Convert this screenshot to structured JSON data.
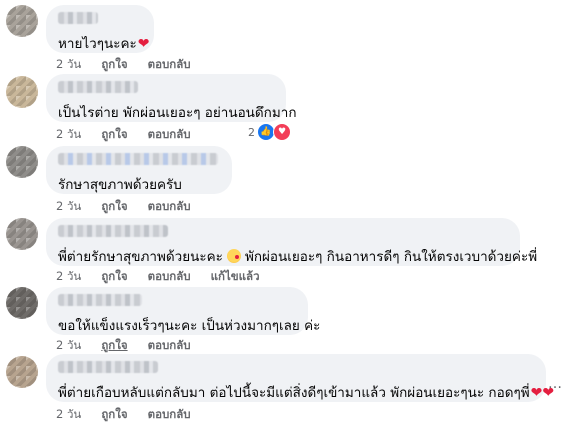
{
  "comments": [
    {
      "text": "หายไวๆนะคะ",
      "heart": "❤",
      "time": "2 วัน",
      "like": "ถูกใจ",
      "reply": "ตอบกลับ",
      "avatar_color": "#a9a39b"
    },
    {
      "text": "เป็นไรต่าย พักผ่อนเยอะๆ อย่านอนดึกมาก",
      "time": "2 วัน",
      "like": "ถูกใจ",
      "reply": "ตอบกลับ",
      "reaction_count": "2",
      "avatar_color": "#c9b79a"
    },
    {
      "text": "รักษาสุขภาพด้วยครับ",
      "time": "2 วัน",
      "like": "ถูกใจ",
      "reply": "ตอบกลับ",
      "avatar_color": "#8f8d8a"
    },
    {
      "text_before": "พี่ต่ายรักษาสุขภาพด้วยนะคะ",
      "emoji": "face-blowing-kiss",
      "text_after": "พักผ่อนเยอะๆ กินอาหารดีๆ กินให้ตรงเวบาด้วยค่ะพี่",
      "time": "2 วัน",
      "like": "ถูกใจ",
      "reply": "ตอบกลับ",
      "edited": "แก้ไขแล้ว",
      "avatar_color": "#9a9591"
    },
    {
      "text": "ขอให้แข็งแรงเร็วๆนะคะ เป็นห่วงมากๆเลย ค่ะ",
      "time": "2 วัน",
      "like": "ถูกใจ",
      "reply": "ตอบกลับ",
      "avatar_color": "#6f6c69"
    },
    {
      "text": "พี่ต่ายเกือบหลับแต่กลับมา ต่อไปนี้จะมีแต่สิ่งดีๆเข้ามาแล้ว พักผ่อนเยอะๆนะ กอดๆพี่",
      "hearts": "❤❤",
      "time": "2 วัน",
      "like": "ถูกใจ",
      "reply": "ตอบกลับ",
      "avatar_color": "#b7a48f"
    }
  ],
  "more_icon": "…",
  "colors": {
    "bubble": "#f0f2f5",
    "meta_text": "#65676b",
    "like_blue": "#1877f2",
    "love_red": "#f33e58"
  }
}
